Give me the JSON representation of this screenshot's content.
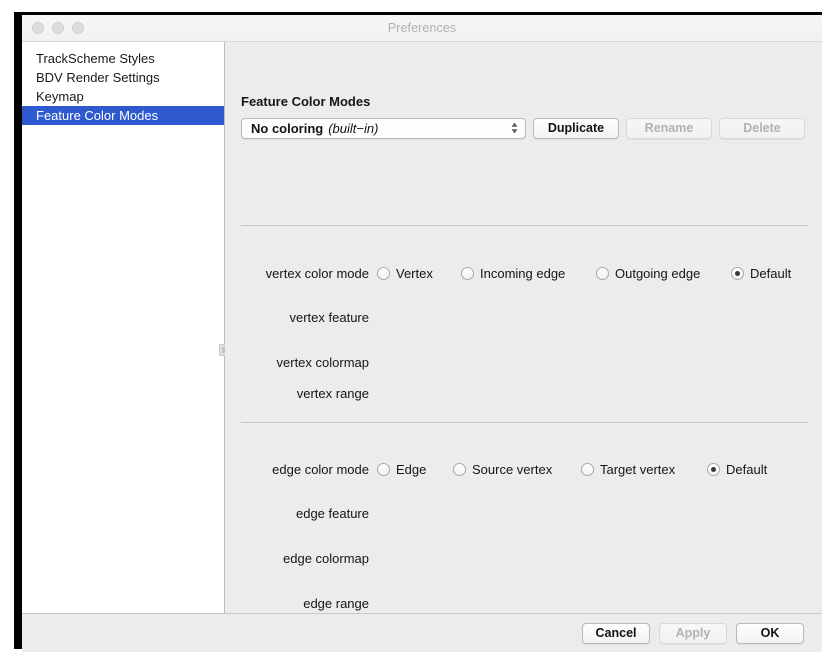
{
  "window": {
    "title": "Preferences",
    "traffic_lights": [
      "close-button",
      "minimize-button",
      "zoom-button"
    ]
  },
  "sidebar": {
    "items": [
      {
        "label": "TrackScheme Styles",
        "selected": false
      },
      {
        "label": "BDV Render Settings",
        "selected": false
      },
      {
        "label": "Keymap",
        "selected": false
      },
      {
        "label": "Feature Color Modes",
        "selected": true
      }
    ]
  },
  "main": {
    "section_title": "Feature Color Modes",
    "combo": {
      "value_name": "No coloring",
      "value_tag": "(built−in)",
      "stepper_icon": "up-down-chevron-icon"
    },
    "buttons": {
      "duplicate": "Duplicate",
      "rename": "Rename",
      "delete": "Delete",
      "rename_disabled": true,
      "delete_disabled": true
    },
    "vertex": {
      "mode_label": "vertex color mode",
      "options": [
        {
          "label": "Vertex",
          "selected": false
        },
        {
          "label": "Incoming edge",
          "selected": false
        },
        {
          "label": "Outgoing edge",
          "selected": false
        },
        {
          "label": "Default",
          "selected": true
        }
      ],
      "feature_label": "vertex feature",
      "colormap_label": "vertex colormap",
      "range_label": "vertex range"
    },
    "edge": {
      "mode_label": "edge color mode",
      "options": [
        {
          "label": "Edge",
          "selected": false
        },
        {
          "label": "Source vertex",
          "selected": false
        },
        {
          "label": "Target vertex",
          "selected": false
        },
        {
          "label": "Default",
          "selected": true
        }
      ],
      "feature_label": "edge feature",
      "colormap_label": "edge colormap",
      "range_label": "edge range"
    }
  },
  "footer": {
    "cancel": "Cancel",
    "apply": "Apply",
    "ok": "OK",
    "apply_disabled": true
  },
  "colors": {
    "selection_blue": "#2f59cf",
    "window_bg": "#ececec",
    "sidebar_bg": "#ffffff",
    "title_text": "#b0b0b0",
    "separator": "#c8c8c8"
  }
}
